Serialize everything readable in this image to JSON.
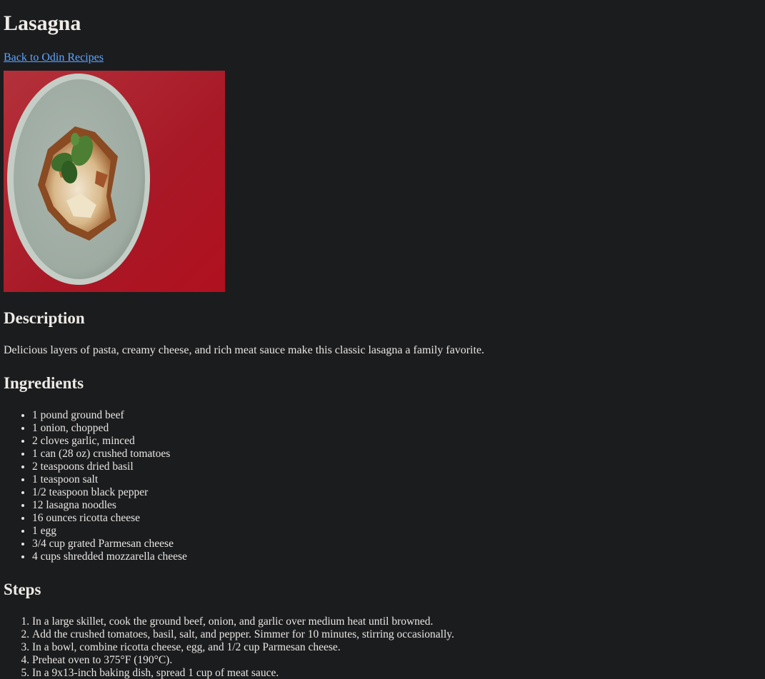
{
  "recipe": {
    "title": "Lasagna",
    "back_link": "Back to Odin Recipes",
    "description_heading": "Description",
    "description": "Delicious layers of pasta, creamy cheese, and rich meat sauce make this classic lasagna a family favorite.",
    "ingredients_heading": "Ingredients",
    "ingredients": [
      "1 pound ground beef",
      "1 onion, chopped",
      "2 cloves garlic, minced",
      "1 can (28 oz) crushed tomatoes",
      "2 teaspoons dried basil",
      "1 teaspoon salt",
      "1/2 teaspoon black pepper",
      "12 lasagna noodles",
      "16 ounces ricotta cheese",
      "1 egg",
      "3/4 cup grated Parmesan cheese",
      "4 cups shredded mozzarella cheese"
    ],
    "steps_heading": "Steps",
    "steps": [
      "In a large skillet, cook the ground beef, onion, and garlic over medium heat until browned.",
      "Add the crushed tomatoes, basil, salt, and pepper. Simmer for 10 minutes, stirring occasionally.",
      "In a bowl, combine ricotta cheese, egg, and 1/2 cup Parmesan cheese.",
      "Preheat oven to 375°F (190°C).",
      "In a 9x13-inch baking dish, spread 1 cup of meat sauce."
    ]
  },
  "colors": {
    "background": "#1b1c1e",
    "text": "#e8e6e3",
    "link": "#5ea4ff",
    "photo_background": "#b01e2a",
    "plate": "#c9d2c9"
  }
}
